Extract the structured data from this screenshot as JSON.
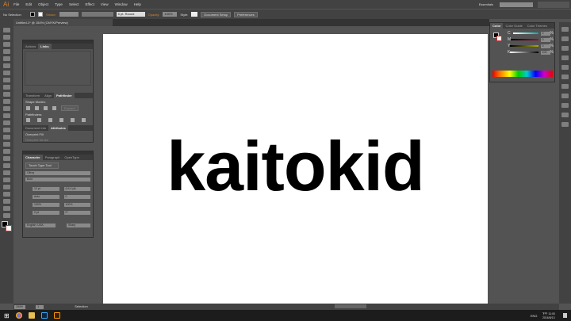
{
  "app": {
    "logo": "Ai",
    "menu": [
      "File",
      "Edit",
      "Object",
      "Type",
      "Select",
      "Effect",
      "View",
      "Window",
      "Help"
    ],
    "workspace": "Essentials"
  },
  "control": {
    "selection": "No Selection",
    "stroke_label": "Stroke:",
    "brush": "5 pt. Round",
    "opacity_label": "Opacity:",
    "opacity": "100%",
    "style_label": "Style:",
    "doc_setup": "Document Setup",
    "preferences": "Preferences"
  },
  "document": {
    "tab": "Untitled-1* @ 154% (CMYK/Preview)",
    "text": "kaitokid"
  },
  "panel1": {
    "tabs": [
      "Actions",
      "Links"
    ],
    "tabs2": [
      "Transform",
      "Align",
      "Pathfinder"
    ],
    "shape_modes": "Shape Modes:",
    "expand": "Expand",
    "pathfinders": "Pathfinders:",
    "tabs3": [
      "Document Info",
      "Attributes"
    ],
    "overprint_fill": "Overprint Fill",
    "overprint_stroke": "Overprint Stroke"
  },
  "character": {
    "tabs": [
      "Character",
      "Paragraph",
      "OpenType"
    ],
    "touch": "Touch Type Tool",
    "font": "Gilroy",
    "style": "Bold",
    "size": "12 pt",
    "leading": "(14.4 pt)",
    "kerning": "Auto",
    "tracking": "0",
    "vscale": "100%",
    "hscale": "100%",
    "baseline": "0 pt",
    "rotation": "0°",
    "language": "English: USA",
    "aa": "Sharp"
  },
  "color": {
    "tabs": [
      "Color",
      "Color Guide",
      "Color Themes"
    ],
    "channels": [
      {
        "name": "C",
        "value": "0"
      },
      {
        "name": "M",
        "value": "0"
      },
      {
        "name": "Y",
        "value": "0"
      },
      {
        "name": "K",
        "value": "100"
      }
    ],
    "unit": "%"
  },
  "status": {
    "zoom": "154%",
    "page": "1",
    "tool": "Selection"
  },
  "taskbar": {
    "lang": "ENG",
    "time": "下午 11:00",
    "date": "2016/8/13"
  }
}
